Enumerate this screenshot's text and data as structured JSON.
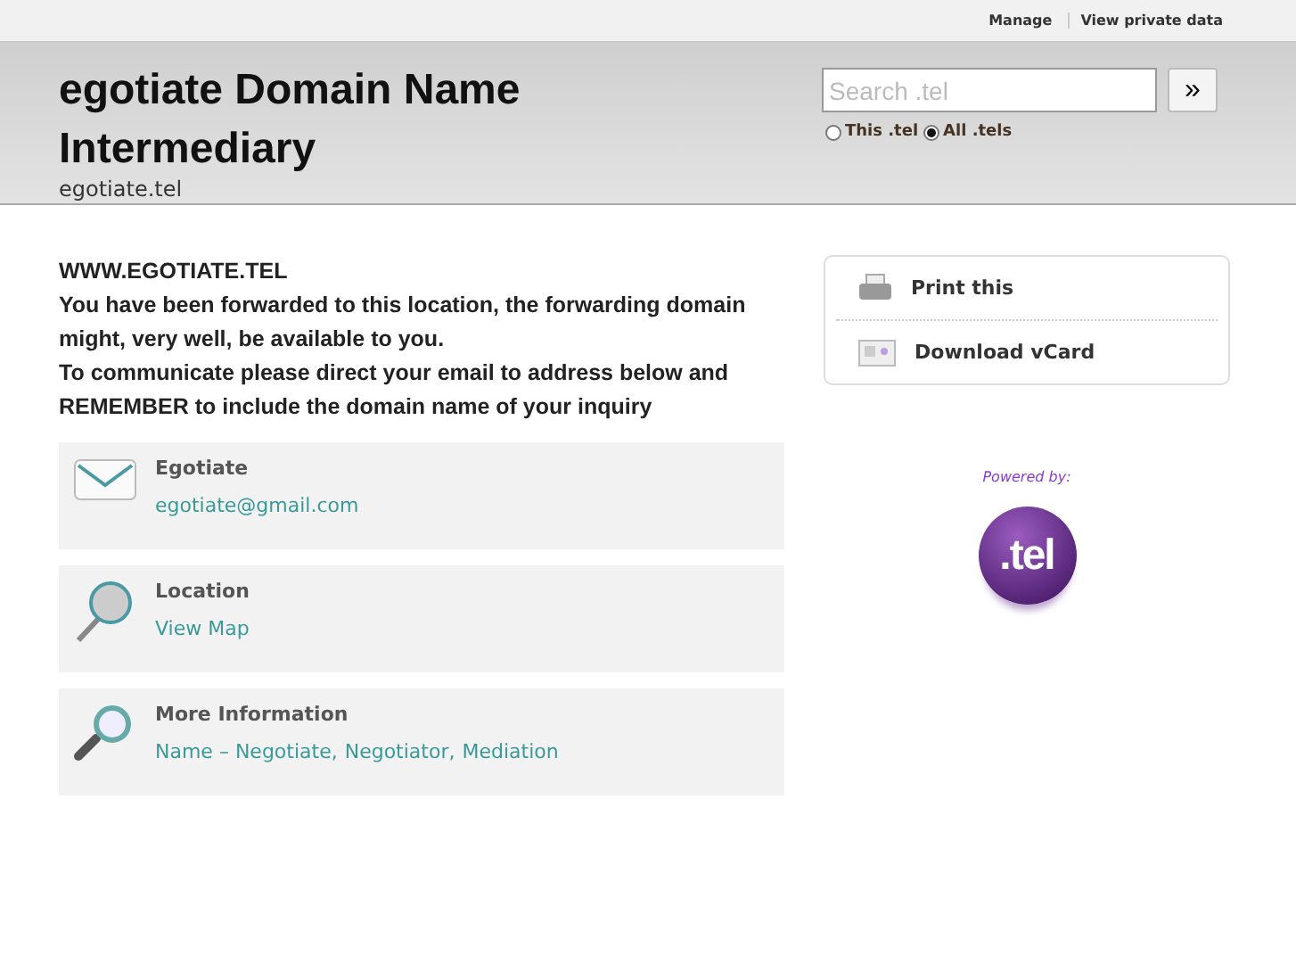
{
  "top_links": [
    "Manage",
    "View private data"
  ],
  "header": {
    "title": "egotiate Domain Name Intermediary",
    "subtitle": "egotiate.tel"
  },
  "search": {
    "placeholder": "Search .tel",
    "button": "»",
    "scopes": [
      {
        "label": "This .tel",
        "selected": false
      },
      {
        "label": "All .tels",
        "selected": true
      }
    ]
  },
  "intro": {
    "heading": "WWW.EGOTIATE.TEL",
    "lines": [
      "You have been forwarded to this location, the forwarding domain might, very well, be available to you.",
      "To communicate please direct your email to address below and REMEMBER to include the domain name of your inquiry"
    ]
  },
  "cards": [
    {
      "kind": "email",
      "title": "Egotiate",
      "links": [
        "egotiate@gmail.com"
      ]
    },
    {
      "kind": "location",
      "title": "Location",
      "links": [
        "View Map"
      ]
    },
    {
      "kind": "info",
      "title": "More Information",
      "links": [
        "Name – Negotiate,",
        "Negotiator,",
        "Mediation"
      ]
    }
  ],
  "actions": [
    {
      "kind": "print",
      "label": "Print this"
    },
    {
      "kind": "vcard",
      "label": "Download vCard"
    }
  ],
  "powered": {
    "label": "Powered by:",
    "logo": ".tel"
  }
}
